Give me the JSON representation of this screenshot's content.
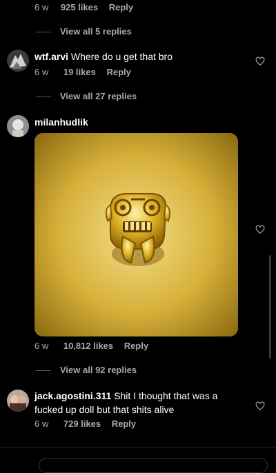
{
  "comment0": {
    "time": "6 w",
    "likes": "925 likes",
    "reply": "Reply",
    "view_all": "View all 5 replies"
  },
  "comment1": {
    "username": "wtf.arvi",
    "text": "Where do u get that bro",
    "time": "6 w",
    "likes": "19 likes",
    "reply": "Reply",
    "view_all": "View all 27 replies"
  },
  "comment2": {
    "username": "milanhudlik",
    "time": "6 w",
    "likes": "10,812 likes",
    "reply": "Reply",
    "view_all": "View all 92 replies"
  },
  "comment3": {
    "username": "jack.agostini.311",
    "text_line1": "Shit I thought that was a",
    "text_line2": "fucked up doll but that shits alive",
    "time": "6 w",
    "likes": "729 likes",
    "reply": "Reply"
  },
  "icons": {
    "like": "heart-icon",
    "image": "golden-idol-image"
  },
  "colors": {
    "background": "#000000",
    "secondary_text": "#a8a8a8",
    "image_gold": "#d8b84a"
  }
}
